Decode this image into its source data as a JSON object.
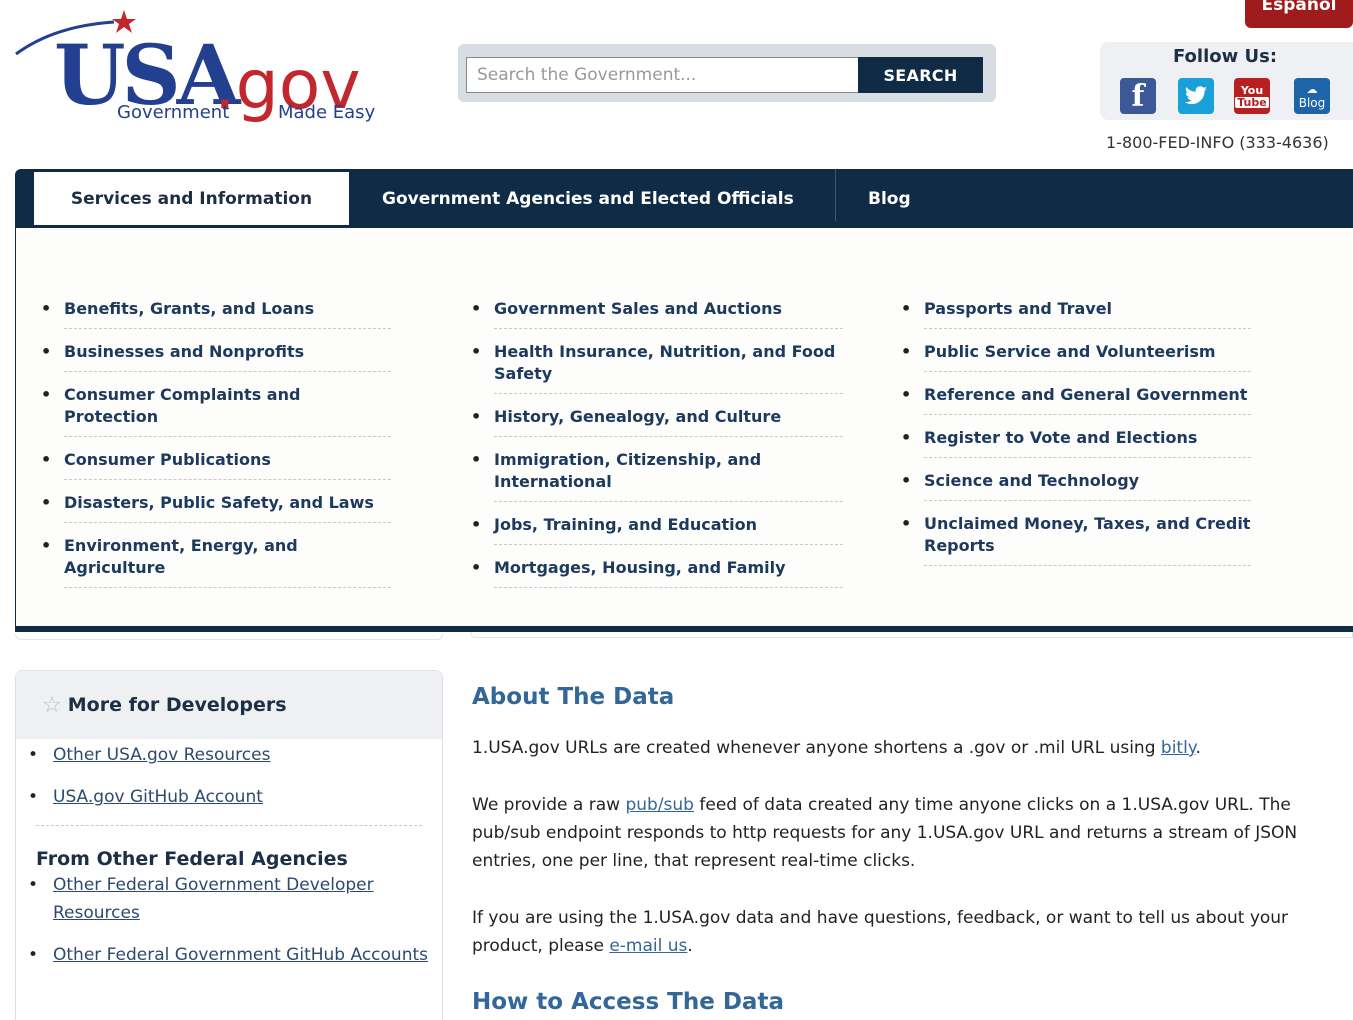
{
  "header": {
    "espanol": "Español",
    "logo": {
      "main": "USA",
      "suffix": ".gov",
      "tag_left": "Government",
      "tag_right": "Made Easy"
    },
    "search": {
      "placeholder": "Search the Government...",
      "button": "SEARCH"
    },
    "follow": {
      "title": "Follow Us:",
      "facebook": "f",
      "youtube_top": "You",
      "youtube_bottom": "Tube",
      "blog": "Blog"
    },
    "phone": "1-800-FED-INFO (333-4636)"
  },
  "nav": {
    "tabs": [
      {
        "label": "Services and Information"
      },
      {
        "label": "Government Agencies and Elected Officials"
      },
      {
        "label": "Blog"
      }
    ]
  },
  "menu": {
    "col1": [
      "Benefits, Grants, and Loans",
      "Businesses and Nonprofits",
      "Consumer Complaints and Protection",
      "Consumer Publications",
      "Disasters, Public Safety, and Laws",
      "Environment, Energy, and Agriculture"
    ],
    "col2": [
      "Government Sales and Auctions",
      "Health Insurance, Nutrition, and Food Safety",
      "History, Genealogy, and Culture",
      "Immigration, Citizenship, and International",
      "Jobs, Training, and Education",
      "Mortgages, Housing, and Family"
    ],
    "col3": [
      "Passports and Travel",
      "Public Service and Volunteerism",
      "Reference and General Government",
      "Register to Vote and Elections",
      "Science and Technology",
      "Unclaimed Money, Taxes, and Credit Reports"
    ]
  },
  "sidebar": {
    "title": "More for Developers",
    "links1": [
      "Other USA.gov Resources",
      "USA.gov GitHub Account"
    ],
    "subheading": "From Other Federal Agencies",
    "links2": [
      "Other Federal Government Developer Resources",
      "Other Federal Government GitHub Accounts"
    ]
  },
  "main": {
    "heading": "About The Data",
    "p1_text": "1.USA.gov URLs are created whenever anyone shortens a .gov or .mil URL using ",
    "p1_link": "bitly",
    "p1_end": ".",
    "p2_text": "We provide a raw ",
    "p2_link": "pub/sub",
    "p2_end": " feed of data created any time anyone clicks on a 1.USA.gov URL. The pub/sub endpoint responds to http requests for any 1.USA.gov URL and returns a stream of JSON entries, one per line, that represent real-time clicks.",
    "p3_text": "If you are using the 1.USA.gov data and have questions, feedback, or want to tell us about your product, please ",
    "p3_link": "e-mail us",
    "p3_end": ".",
    "heading2": "How to Access The Data"
  },
  "colors": {
    "navy": "#0f2b46",
    "link": "#336699",
    "logo_blue": "#233f8f",
    "logo_red": "#c1272d"
  }
}
